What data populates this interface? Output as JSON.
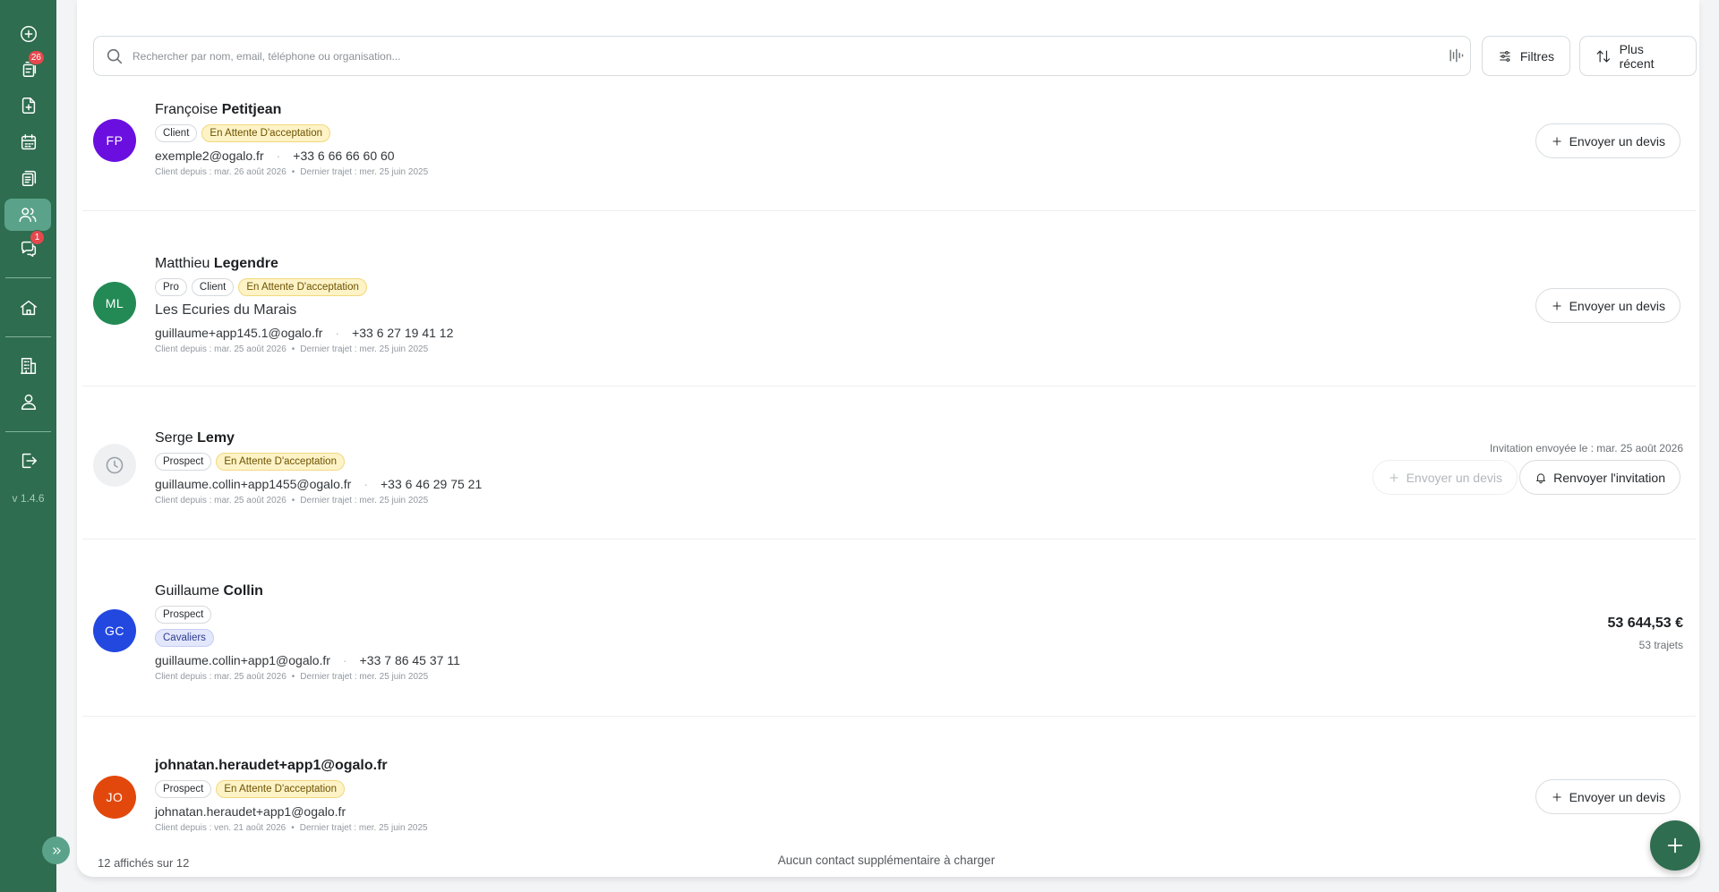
{
  "app": {
    "version": "v 1.4.6",
    "accent": "#2e6d4f"
  },
  "sidebar": {
    "items": [
      {
        "name": "new-icon",
        "badge": ""
      },
      {
        "name": "missions-icon",
        "badge": "26"
      },
      {
        "name": "quotes-icon",
        "badge": ""
      },
      {
        "name": "calendar-icon",
        "badge": ""
      },
      {
        "name": "documents-icon",
        "badge": ""
      },
      {
        "name": "contacts-icon",
        "badge": "",
        "active": true
      },
      {
        "name": "messages-icon",
        "badge": "1"
      },
      {
        "name": "home-icon",
        "badge": ""
      },
      {
        "name": "company-icon",
        "badge": ""
      },
      {
        "name": "profile-icon",
        "badge": ""
      },
      {
        "name": "logout-icon",
        "badge": ""
      }
    ]
  },
  "search": {
    "placeholder": "Rechercher par nom, email, téléphone ou organisation..."
  },
  "toolbar": {
    "filters_label": "Filtres",
    "sort_label": "Plus récent"
  },
  "contacts": [
    {
      "initials": "FP",
      "avatar_color": "#6a0fe0",
      "first_name": "Françoise",
      "last_name": "Petitjean",
      "tags": [
        "Client"
      ],
      "status": "En Attente D'acceptation",
      "group": "",
      "organization": "",
      "email": "exemple2@ogalo.fr",
      "phone": "+33 6 66 66 60 60",
      "client_since": "Client depuis : mar. 26 août 2026",
      "last_trip": "Dernier trajet : mer. 25 juin 2025",
      "action": "Envoyer un devis"
    },
    {
      "initials": "ML",
      "avatar_color": "#238a55",
      "first_name": "Matthieu",
      "last_name": "Legendre",
      "tags": [
        "Pro",
        "Client"
      ],
      "status": "En Attente D'acceptation",
      "group": "",
      "organization": "Les Ecuries du Marais",
      "email": "guillaume+app145.1@ogalo.fr",
      "phone": "+33 6 27 19 41 12",
      "client_since": "Client depuis : mar. 25 août 2026",
      "last_trip": "Dernier trajet : mer. 25 juin 2025",
      "action": "Envoyer un devis"
    },
    {
      "initials": "",
      "avatar_color": "#eef0f2",
      "first_name": "Serge",
      "last_name": "Lemy",
      "tags": [
        "Prospect"
      ],
      "status": "En Attente D'acceptation",
      "group": "",
      "organization": "",
      "email": "guillaume.collin+app1455@ogalo.fr",
      "phone": "+33 6 46 29 75 21",
      "client_since": "Client depuis : mar. 25 août 2026",
      "last_trip": "Dernier trajet : mer. 25 juin 2025",
      "invite_note": "Invitation envoyée le : mar. 25 août 2026",
      "action": "Envoyer un devis",
      "resend": "Renvoyer l'invitation"
    },
    {
      "initials": "GC",
      "avatar_color": "#2348e0",
      "first_name": "Guillaume",
      "last_name": "Collin",
      "tags": [
        "Prospect"
      ],
      "status": "",
      "group": "Cavaliers",
      "organization": "",
      "email": "guillaume.collin+app1@ogalo.fr",
      "phone": "+33 7 86 45 37 11",
      "client_since": "Client depuis : mar. 25 août 2026",
      "last_trip": "Dernier trajet : mer. 25 juin 2025",
      "amount": "53 644,53 €",
      "trips": "53 trajets"
    },
    {
      "initials": "JO",
      "avatar_color": "#e2480c",
      "first_name": "",
      "last_name": "johnatan.heraudet+app1@ogalo.fr",
      "tags": [
        "Prospect"
      ],
      "status": "En Attente D'acceptation",
      "group": "",
      "organization": "",
      "email": "johnatan.heraudet+app1@ogalo.fr",
      "phone": "",
      "client_since": "Client depuis : ven. 21 août 2026",
      "last_trip": "Dernier trajet : mer. 25 juin 2025",
      "action": "Envoyer un devis"
    }
  ],
  "footer": {
    "count": "12 affichés sur 12",
    "status": "Aucun contact supplémentaire à charger"
  }
}
